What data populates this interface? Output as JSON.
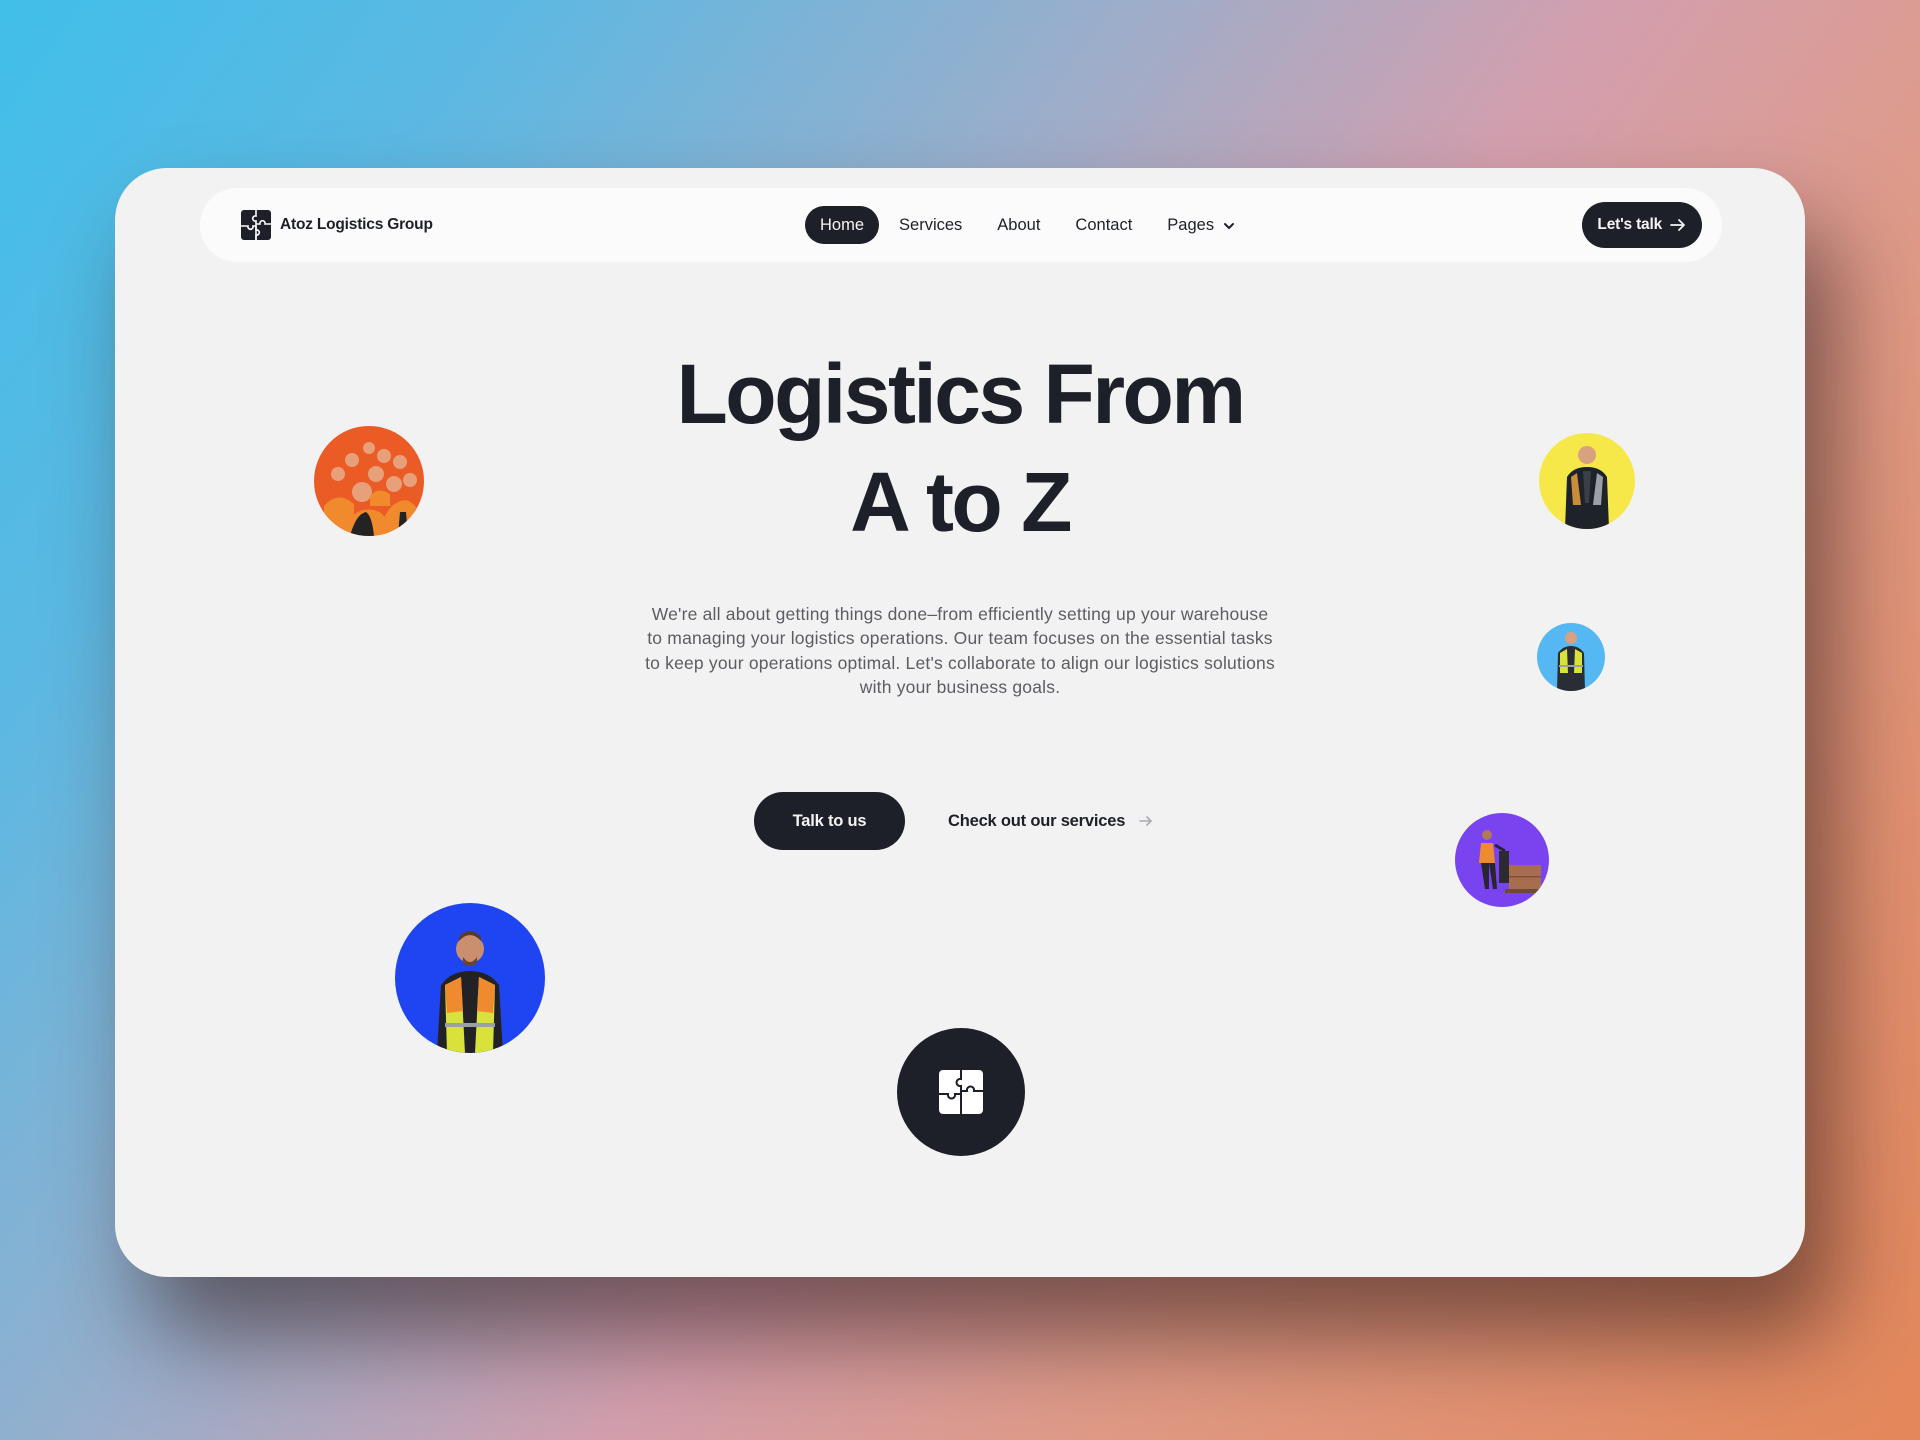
{
  "colors": {
    "ink": "#1e2029",
    "card_background": "#f2f2f2",
    "nav_background": "#fbfbfb",
    "body_text": "#5c5d63",
    "bubble_orange": "#ea5b25",
    "bubble_yellow": "#f7e84a",
    "bubble_light_blue": "#55b8f2",
    "bubble_purple": "#7a43f0",
    "bubble_blue": "#1f44f1"
  },
  "brand": {
    "name": "Atoz Logistics Group",
    "icon": "puzzle-icon"
  },
  "nav": {
    "items": [
      {
        "label": "Home",
        "active": true
      },
      {
        "label": "Services",
        "active": false
      },
      {
        "label": "About",
        "active": false
      },
      {
        "label": "Contact",
        "active": false
      },
      {
        "label": "Pages",
        "active": false,
        "icon": "chevron-down-icon"
      }
    ],
    "cta": {
      "label": "Let's talk",
      "icon": "arrow-right-icon"
    }
  },
  "hero": {
    "title_line_1": "Logistics From",
    "title_line_2": "A to Z",
    "description": "We're all about getting things done–from efficiently setting up your warehouse to managing your logistics operations. Our team focuses on the essential tasks to keep your operations optimal. Let's collaborate to align our logistics solutions with your business goals.",
    "primary_button": "Talk to us",
    "secondary_link": {
      "label": "Check out our services",
      "icon": "arrow-right-icon"
    }
  },
  "bubbles": [
    {
      "name": "team-photo",
      "subject": "group of workers in orange vests",
      "color": "orange"
    },
    {
      "name": "worker-photo-yellow",
      "subject": "worker in hi-vis vest",
      "color": "yellow"
    },
    {
      "name": "worker-photo-light-blue",
      "subject": "worker in yellow vest",
      "color": "light-blue"
    },
    {
      "name": "worker-pallet-photo",
      "subject": "worker with pallet jack",
      "color": "purple"
    },
    {
      "name": "worker-photo-blue",
      "subject": "smiling worker in hi-vis vest",
      "color": "blue"
    },
    {
      "name": "puzzle-badge",
      "subject": "puzzle icon",
      "color": "dark"
    }
  ]
}
